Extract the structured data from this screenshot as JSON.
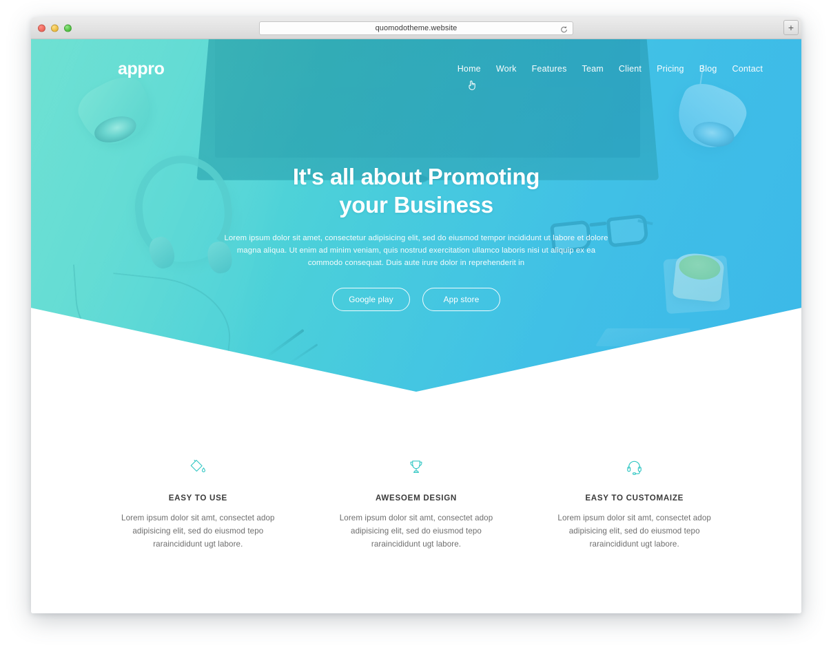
{
  "browser": {
    "url": "quomodotheme.website",
    "reload_icon": "reload-icon",
    "new_tab_label": "+",
    "traffic_lights": [
      "close-red",
      "minimize-yellow",
      "zoom-green"
    ]
  },
  "site": {
    "brand": "appro",
    "nav": [
      {
        "label": "Home",
        "active": true
      },
      {
        "label": "Work",
        "active": false
      },
      {
        "label": "Features",
        "active": false
      },
      {
        "label": "Team",
        "active": false
      },
      {
        "label": "Client",
        "active": false
      },
      {
        "label": "Pricing",
        "active": false
      },
      {
        "label": "Blog",
        "active": false
      },
      {
        "label": "Contact",
        "active": false
      }
    ],
    "hero": {
      "title_line1": "It's all about Promoting",
      "title_line2": "your Business",
      "paragraph": "Lorem ipsum dolor sit amet, consectetur adipisicing elit, sed do eiusmod tempor incididunt ut labore et dolore magna aliqua. Ut enim ad minim veniam, quis nostrud exercitation ullamco laboris nisi ut aliquip ex ea commodo consequat. Duis aute irure dolor in reprehenderit in",
      "buttons": [
        {
          "label": "Google play"
        },
        {
          "label": "App store"
        }
      ]
    },
    "features": [
      {
        "icon": "paint-bucket-icon",
        "title": "EASY TO USE",
        "text": "Lorem ipsum dolor sit amt, consectet adop adipisicing elit, sed do eiusmod tepo raraincididunt ugt labore."
      },
      {
        "icon": "trophy-icon",
        "title": "AWESOEM DESIGN",
        "text": "Lorem ipsum dolor sit amt, consectet adop adipisicing elit, sed do eiusmod tepo raraincididunt ugt labore."
      },
      {
        "icon": "headset-icon",
        "title": "EASY TO CUSTOMAIZE",
        "text": "Lorem ipsum dolor sit amt, consectet adop adipisicing elit, sed do eiusmod tepo raraincididunt ugt labore."
      }
    ]
  },
  "colors": {
    "hero_teal_left": "#61ddd0",
    "hero_blue_right": "#3fbbe8",
    "monitor_dark_teal": "#1f8d9a",
    "feature_icon": "#33c7c4",
    "heading_text": "#3a3a3a",
    "body_text": "#6d6d6d"
  }
}
